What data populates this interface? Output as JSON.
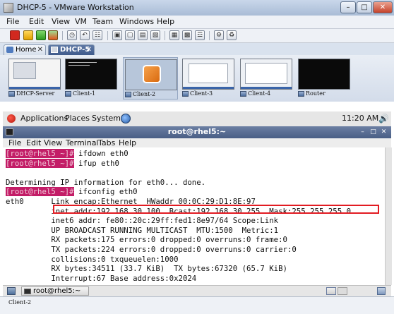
{
  "window": {
    "title": "DHCP-5 - VMware Workstation"
  },
  "menu": [
    "File",
    "Edit",
    "View",
    "VM",
    "Team",
    "Windows",
    "Help"
  ],
  "tabs": [
    {
      "label": "Home"
    },
    {
      "label": "DHCP-5"
    }
  ],
  "thumbnails": [
    {
      "label": "DHCP-Server"
    },
    {
      "label": "Client-1"
    },
    {
      "label": "Client-2"
    },
    {
      "label": "Client-3"
    },
    {
      "label": "Client-4"
    },
    {
      "label": "Router"
    }
  ],
  "gnome_panel": {
    "applications": "Applications",
    "places": "Places",
    "system": "System",
    "clock": "11:20 AM"
  },
  "terminal": {
    "title": "root@rhel5:~",
    "menu": [
      "File",
      "Edit",
      "View",
      "Terminal",
      "Tabs",
      "Help"
    ],
    "prompt": "[root@rhel5 ~]#",
    "lines": [
      {
        "prompt": true,
        "text": " ifdown eth0"
      },
      {
        "prompt": true,
        "text": " ifup eth0"
      },
      {
        "prompt": false,
        "text": ""
      },
      {
        "prompt": false,
        "text": "Determining IP information for eth0... done."
      },
      {
        "prompt": true,
        "text": " ifconfig eth0"
      },
      {
        "prompt": false,
        "text": "eth0      Link encap:Ethernet  HWaddr 00:0C:29:D1:8E:97"
      },
      {
        "prompt": false,
        "text": "          inet addr:192.168.30.100  Bcast:192.168.30.255  Mask:255.255.255.0"
      },
      {
        "prompt": false,
        "text": "          inet6 addr: fe80::20c:29ff:fed1:8e97/64 Scope:Link"
      },
      {
        "prompt": false,
        "text": "          UP BROADCAST RUNNING MULTICAST  MTU:1500  Metric:1"
      },
      {
        "prompt": false,
        "text": "          RX packets:175 errors:0 dropped:0 overruns:0 frame:0"
      },
      {
        "prompt": false,
        "text": "          TX packets:224 errors:0 dropped:0 overruns:0 carrier:0"
      },
      {
        "prompt": false,
        "text": "          collisions:0 txqueuelen:1000"
      },
      {
        "prompt": false,
        "text": "          RX bytes:34511 (33.7 KiB)  TX bytes:67320 (65.7 KiB)"
      },
      {
        "prompt": false,
        "text": "          Interrupt:67 Base address:0x2024"
      }
    ]
  },
  "taskbar": {
    "item": "root@rhel5:~"
  },
  "statusbar": {
    "vm_name": "Client-2"
  },
  "colors": {
    "prompt_bg": "#c31d67",
    "highlight_border": "#e21b22",
    "term_title": "#495e85"
  }
}
